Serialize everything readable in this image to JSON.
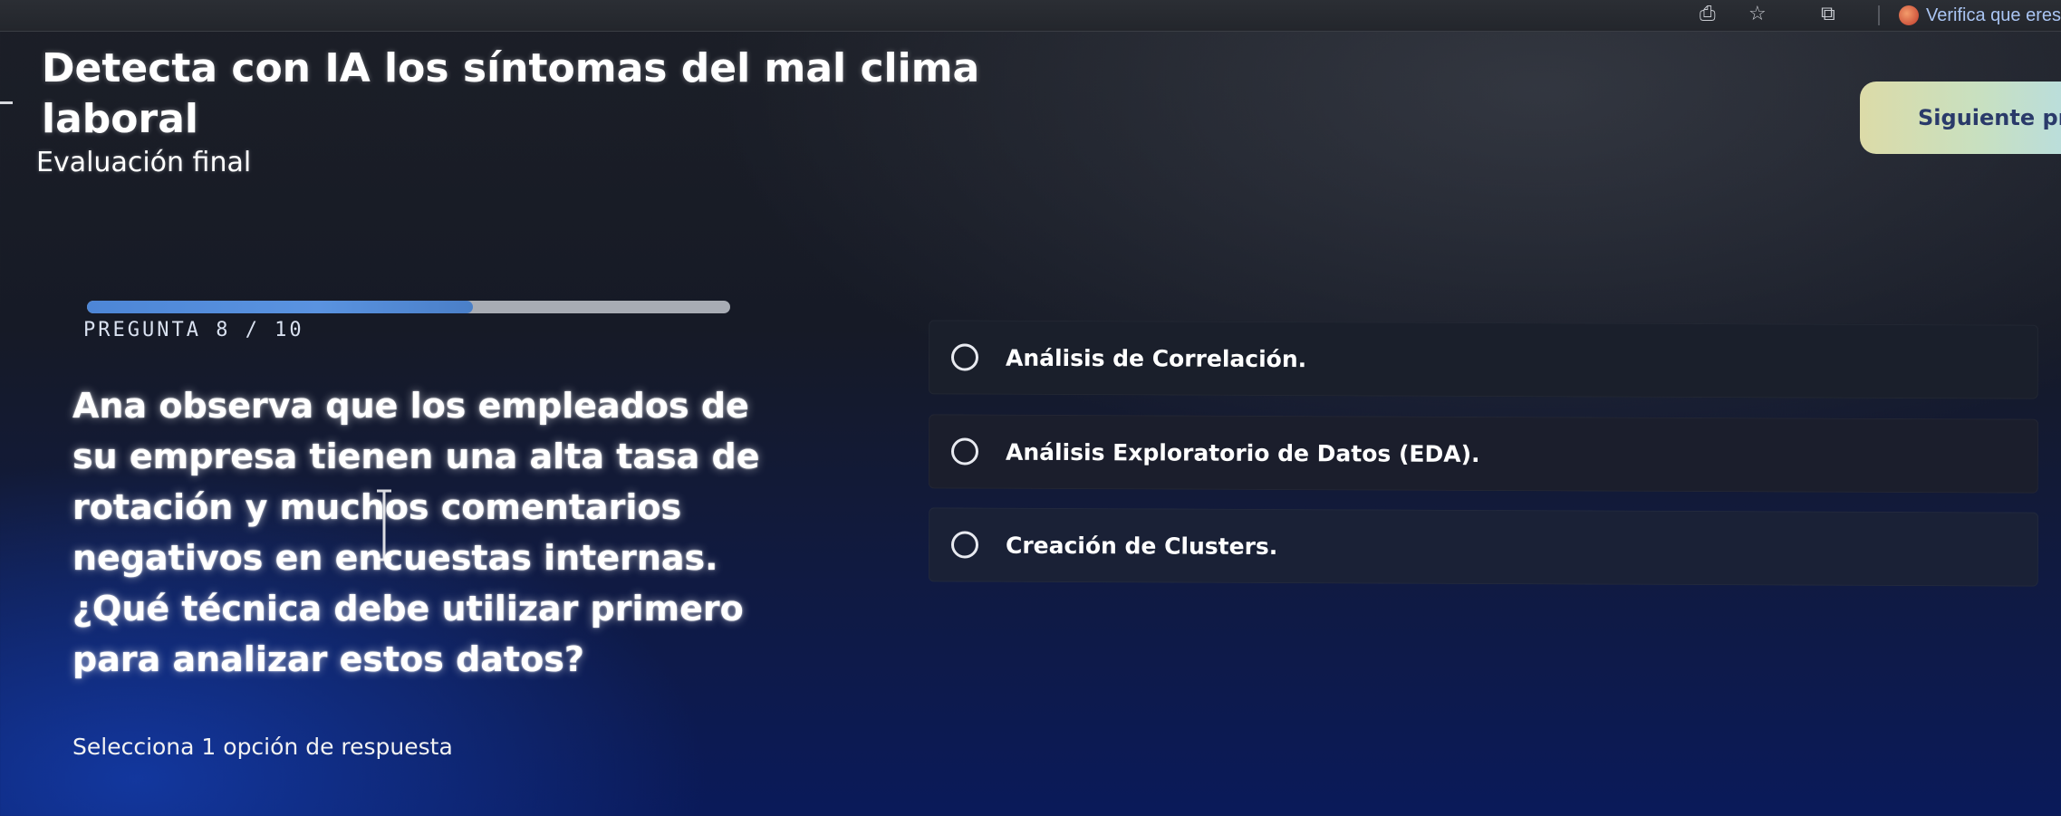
{
  "browser": {
    "verify_text": "Verifica que eres",
    "icons": [
      "download-icon",
      "star-icon",
      "extensions-icon"
    ]
  },
  "header": {
    "course_title": "Detecta con IA los síntomas del mal clima laboral",
    "section": "Evaluación final",
    "next_button": "Siguiente pr"
  },
  "progress": {
    "counter": "PREGUNTA 8 / 10",
    "current": 8,
    "total": 10,
    "fill_fraction": 0.6,
    "fill_color": "#4d86d6"
  },
  "question": {
    "text": "Ana observa que los empleados de su empresa tienen una alta tasa de rotación y muchos comentarios negativos en encuestas internas. ¿Qué técnica debe utilizar primero para analizar estos datos?",
    "hint": "Selecciona 1 opción de respuesta"
  },
  "options": [
    {
      "label": "Análisis de Correlación."
    },
    {
      "label": "Análisis Exploratorio de Datos (EDA)."
    },
    {
      "label": "Creación de Clusters."
    }
  ],
  "colors": {
    "background_top": "#1c1f27",
    "background_bottom": "#0a1a5a",
    "option_bg": "#1a1f2b",
    "next_button_text": "#2a3a6a"
  }
}
